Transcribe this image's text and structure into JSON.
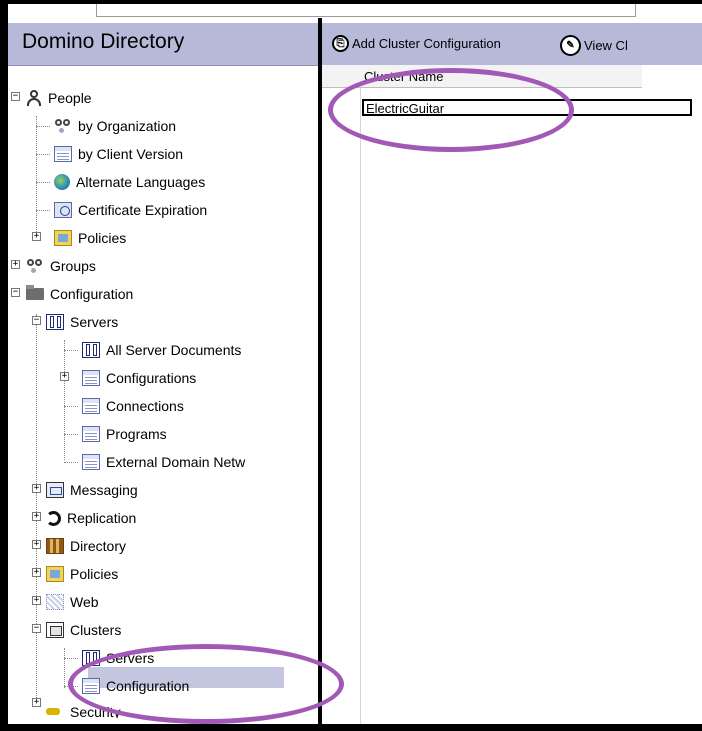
{
  "left_pane": {
    "title": "Domino Directory",
    "tree": [
      {
        "label": "People"
      },
      {
        "label": "by Organization"
      },
      {
        "label": "by Client Version"
      },
      {
        "label": "Alternate Languages"
      },
      {
        "label": "Certificate Expiration"
      },
      {
        "label": "Policies"
      },
      {
        "label": "Groups"
      },
      {
        "label": "Configuration"
      },
      {
        "label": "Servers"
      },
      {
        "label": "All Server Documents"
      },
      {
        "label": "Configurations"
      },
      {
        "label": "Connections"
      },
      {
        "label": "Programs"
      },
      {
        "label": "External Domain Netw"
      },
      {
        "label": "Messaging"
      },
      {
        "label": "Replication"
      },
      {
        "label": "Directory"
      },
      {
        "label": "Policies"
      },
      {
        "label": "Web"
      },
      {
        "label": "Clusters"
      },
      {
        "label": "Servers"
      },
      {
        "label": "Configuration"
      },
      {
        "label": "Security"
      }
    ]
  },
  "toolbar": {
    "add_label": "Add Cluster Configuration",
    "view_label": "View Cl"
  },
  "view": {
    "column_header": "Cluster Name",
    "rows": [
      "ElectricGuitar"
    ]
  },
  "colors": {
    "pane_header": "#b7b9d9",
    "selection": "#c4c6e0",
    "annotation": "#a159b5"
  }
}
